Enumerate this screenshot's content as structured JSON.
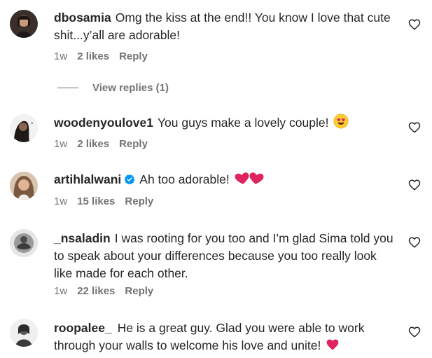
{
  "comments": [
    {
      "username": "dbosamia",
      "text": "Omg the kiss at the end!! You know I love that cute shit...y’all are adorable!",
      "time": "1w",
      "likes": "2 likes",
      "reply": "Reply",
      "view_replies": "View replies (1)"
    },
    {
      "username": "woodenyoulove1",
      "text": "You guys make a lovely couple!",
      "time": "1w",
      "likes": "2 likes",
      "reply": "Reply",
      "emoji": "heart-eyes-emoji"
    },
    {
      "username": "artihlalwani",
      "text": "Ah too adorable!",
      "time": "1w",
      "likes": "15 likes",
      "reply": "Reply",
      "verified": true,
      "emoji": "two-hearts-emoji"
    },
    {
      "username": "_nsaladin",
      "text": "I was rooting for you too and I’m glad Sima told you to speak about your differences because you too really look like made for each other.",
      "time": "1w",
      "likes": "22 likes",
      "reply": "Reply"
    },
    {
      "username": "roopalee_",
      "text": "He is a great guy. Glad you were able to work through your walls to welcome his love and unite!",
      "emoji": "red-heart-emoji"
    }
  ],
  "colors": {
    "text": "#262626",
    "meta": "#737373",
    "verified_blue": "#0095f6",
    "heart_red": "#e0245e"
  }
}
